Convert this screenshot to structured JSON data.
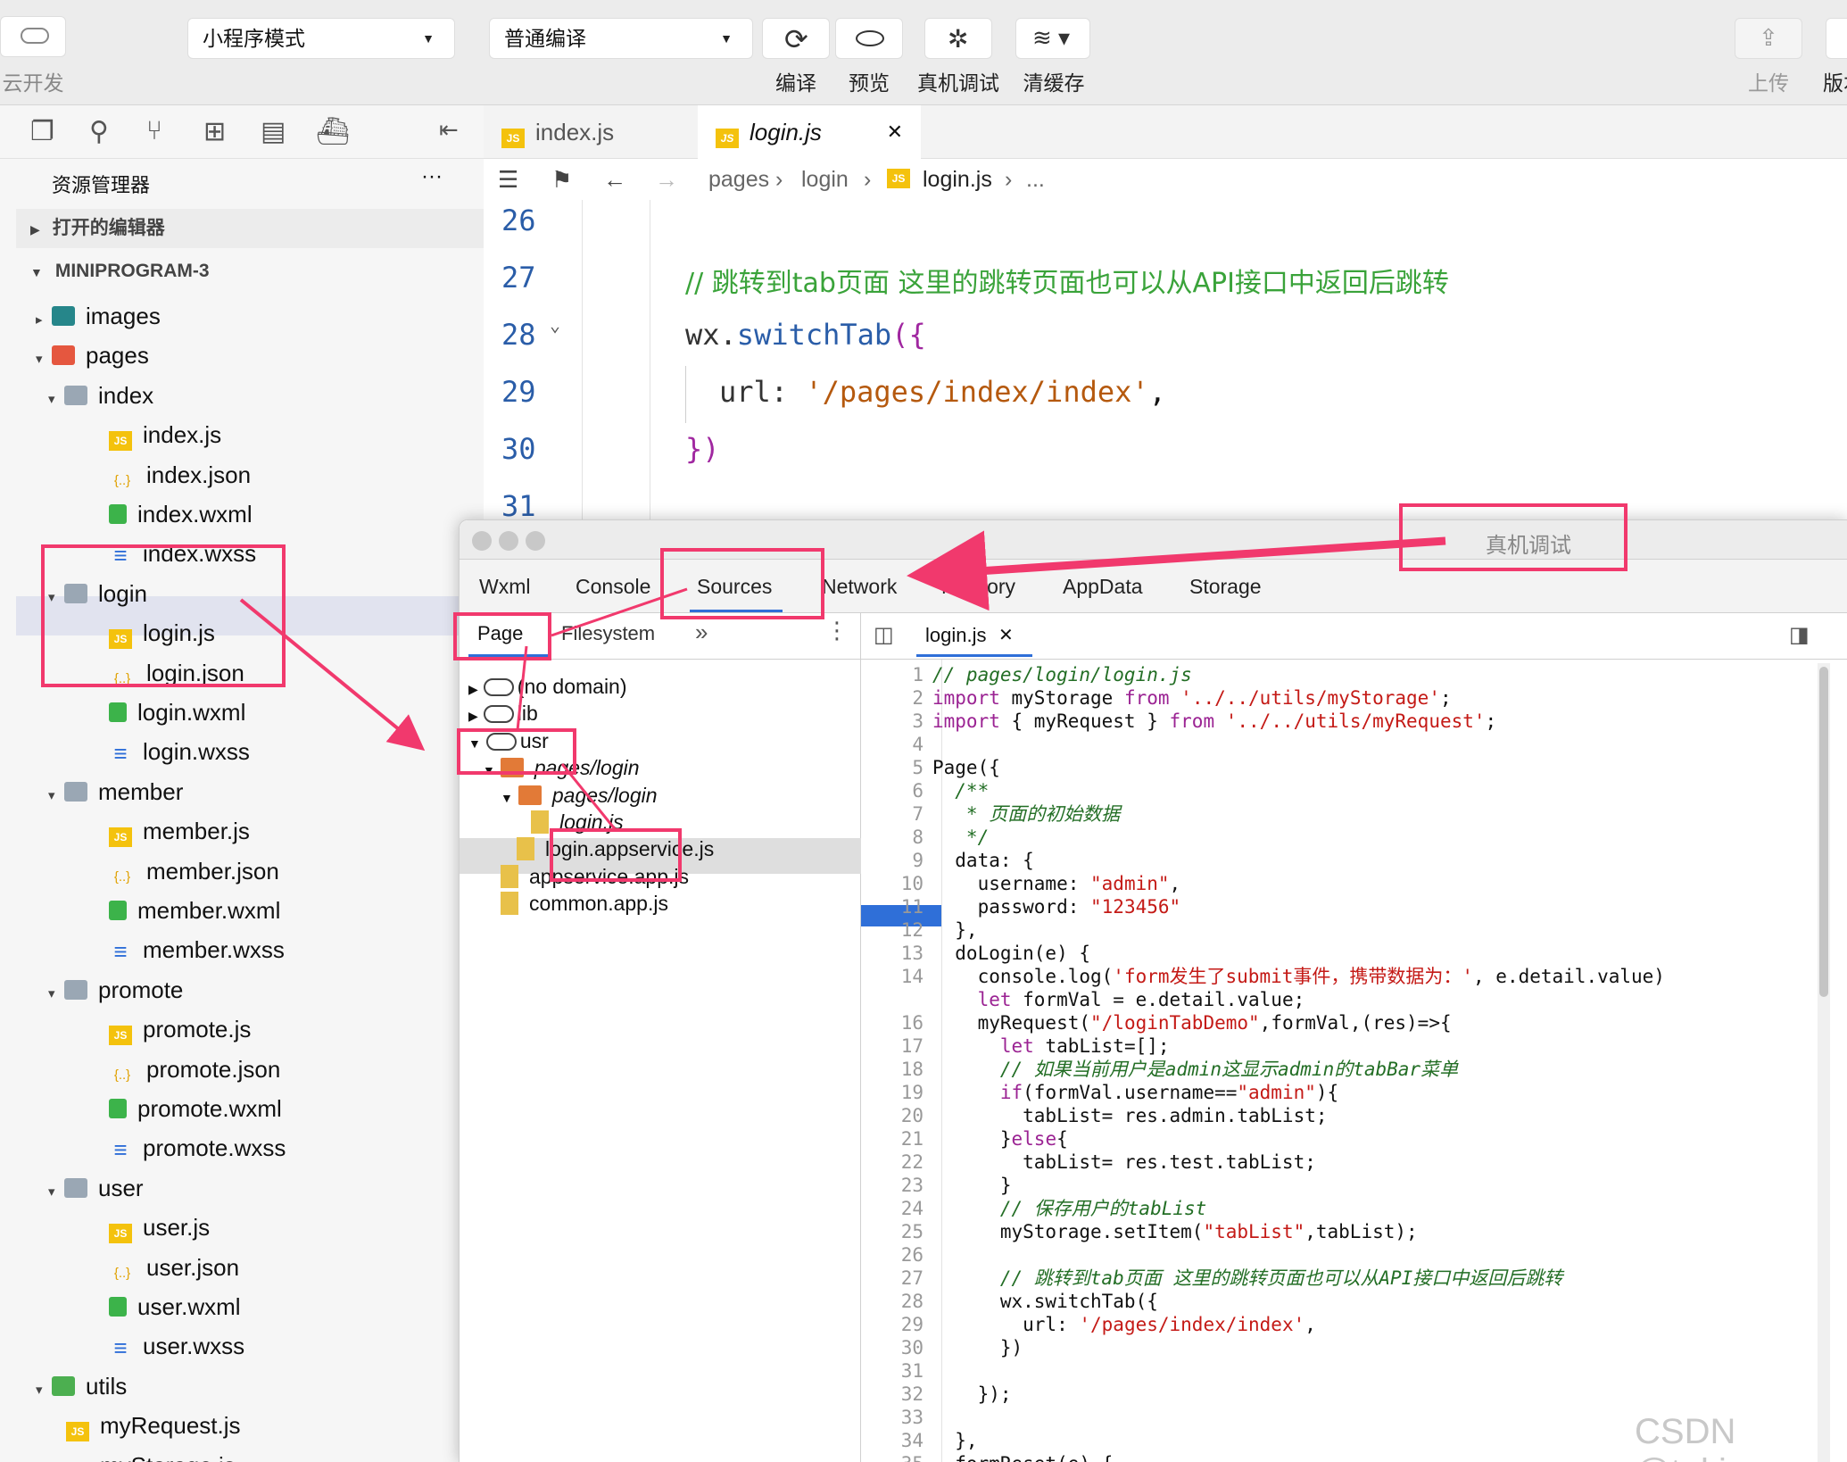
{
  "toolbar": {
    "cloud_label": "云开发",
    "mode_select": "小程序模式",
    "compile_select": "普通编译",
    "compile_label": "编译",
    "preview_label": "预览",
    "remote_debug_label": "真机调试",
    "clear_cache_label": "清缓存",
    "upload_label": "上传",
    "version_label": "版本"
  },
  "explorer": {
    "title": "资源管理器",
    "more": "···",
    "open_editors": "打开的编辑器",
    "project": "MINIPROGRAM-3",
    "items": [
      {
        "label": "images",
        "type": "folder-teal",
        "depth": 0,
        "arrow": "▸"
      },
      {
        "label": "pages",
        "type": "folder-red",
        "depth": 0,
        "arrow": "▾"
      },
      {
        "label": "index",
        "type": "folder",
        "depth": 1,
        "arrow": "▾"
      },
      {
        "label": "index.js",
        "type": "js",
        "depth": 2,
        "arrow": ""
      },
      {
        "label": "index.json",
        "type": "json",
        "depth": 2,
        "arrow": ""
      },
      {
        "label": "index.wxml",
        "type": "wxml",
        "depth": 2,
        "arrow": ""
      },
      {
        "label": "index.wxss",
        "type": "wxss",
        "depth": 2,
        "arrow": ""
      },
      {
        "label": "login",
        "type": "folder",
        "depth": 1,
        "arrow": "▾"
      },
      {
        "label": "login.js",
        "type": "js",
        "depth": 2,
        "arrow": ""
      },
      {
        "label": "login.json",
        "type": "json",
        "depth": 2,
        "arrow": ""
      },
      {
        "label": "login.wxml",
        "type": "wxml",
        "depth": 2,
        "arrow": ""
      },
      {
        "label": "login.wxss",
        "type": "wxss",
        "depth": 2,
        "arrow": ""
      },
      {
        "label": "member",
        "type": "folder",
        "depth": 1,
        "arrow": "▾"
      },
      {
        "label": "member.js",
        "type": "js",
        "depth": 2,
        "arrow": ""
      },
      {
        "label": "member.json",
        "type": "json",
        "depth": 2,
        "arrow": ""
      },
      {
        "label": "member.wxml",
        "type": "wxml",
        "depth": 2,
        "arrow": ""
      },
      {
        "label": "member.wxss",
        "type": "wxss",
        "depth": 2,
        "arrow": ""
      },
      {
        "label": "promote",
        "type": "folder",
        "depth": 1,
        "arrow": "▾"
      },
      {
        "label": "promote.js",
        "type": "js",
        "depth": 2,
        "arrow": ""
      },
      {
        "label": "promote.json",
        "type": "json",
        "depth": 2,
        "arrow": ""
      },
      {
        "label": "promote.wxml",
        "type": "wxml",
        "depth": 2,
        "arrow": ""
      },
      {
        "label": "promote.wxss",
        "type": "wxss",
        "depth": 2,
        "arrow": ""
      },
      {
        "label": "user",
        "type": "folder",
        "depth": 1,
        "arrow": "▾"
      },
      {
        "label": "user.js",
        "type": "js",
        "depth": 2,
        "arrow": ""
      },
      {
        "label": "user.json",
        "type": "json",
        "depth": 2,
        "arrow": ""
      },
      {
        "label": "user.wxml",
        "type": "wxml",
        "depth": 2,
        "arrow": ""
      },
      {
        "label": "user.wxss",
        "type": "wxss",
        "depth": 2,
        "arrow": ""
      },
      {
        "label": "utils",
        "type": "folder-green",
        "depth": 0,
        "arrow": "▾"
      },
      {
        "label": "myRequest.js",
        "type": "js",
        "depth": 1,
        "arrow": ""
      },
      {
        "label": "myStorage.js",
        "type": "js",
        "depth": 1,
        "arrow": ""
      }
    ]
  },
  "editor": {
    "tabs": [
      "index.js",
      "login.js"
    ],
    "close": "✕",
    "breadcrumb": [
      "pages",
      "login",
      "login.js",
      "..."
    ],
    "line_numbers": [
      "26",
      "27",
      "28",
      "29",
      "30",
      "31"
    ],
    "line27": "// 跳转到tab页面 这里的跳转页面也可以从API接口中返回后跳转",
    "line28_a": "wx.",
    "line28_b": "switchTab",
    "line28_c": "({",
    "line29_a": "url: ",
    "line29_b": "'/pages/index/index'",
    "line29_c": ",",
    "line30": "})"
  },
  "devtools": {
    "title": "真机调试",
    "tabs": [
      "Wxml",
      "Console",
      "Sources",
      "Network",
      "Memory",
      "AppData",
      "Storage"
    ],
    "subtabs": [
      "Page",
      "Filesystem",
      "»"
    ],
    "tree": [
      {
        "label": "(no domain)",
        "kind": "cloud",
        "arrow": "▶"
      },
      {
        "label": "lib",
        "kind": "cloud",
        "arrow": "▶"
      },
      {
        "label": "usr",
        "kind": "cloud",
        "arrow": "▼"
      },
      {
        "label": "pages/login",
        "kind": "folder",
        "arrow": "▼"
      },
      {
        "label": "pages/login",
        "kind": "folder",
        "arrow": "▼"
      },
      {
        "label": "login.js",
        "kind": "file",
        "arrow": ""
      },
      {
        "label": "login.appservice.js",
        "kind": "file",
        "arrow": ""
      },
      {
        "label": "appservice.app.js",
        "kind": "file",
        "arrow": ""
      },
      {
        "label": "common.app.js",
        "kind": "file",
        "arrow": ""
      }
    ],
    "file_tab": "login.js",
    "file_tab_close": "✕",
    "breakpoint_line": "15",
    "code": [
      "// pages/login/login.js",
      "import myStorage from '../../utils/myStorage';",
      "import { myRequest } from '../../utils/myRequest';",
      "",
      "Page({",
      "  /**",
      "   * 页面的初始数据",
      "   */",
      "  data: {",
      "    username: \"admin\",",
      "    password: \"123456\"",
      "  },",
      "  doLogin(e) {",
      "    console.log('form发生了submit事件，携带数据为：', e.detail.value)",
      "    let formVal = e.detail.value;",
      "    myRequest(\"/loginTabDemo\",formVal,(res)=>{",
      "      let tabList=[];",
      "      // 如果当前用户是admin这显示admin的tabBar菜单",
      "      if(formVal.username==\"admin\"){",
      "        tabList= res.admin.tabList;",
      "      }else{",
      "        tabList= res.test.tabList;",
      "      }",
      "      // 保存用户的tabList",
      "      myStorage.setItem(\"tabList\",tabList);",
      "",
      "      // 跳转到tab页面 这里的跳转页面也可以从API接口中返回后跳转",
      "      wx.switchTab({",
      "        url: '/pages/index/index',",
      "      })",
      "",
      "    });",
      "",
      "  },",
      "  formReset(e) {"
    ]
  },
  "watermark": "CSDN @tekin",
  "colors": {
    "annotation": "#f1396d",
    "breakpoint": "#2f6fd8",
    "comment": "#236e25",
    "string": "#c41a16",
    "keyword": "#9b2393"
  }
}
